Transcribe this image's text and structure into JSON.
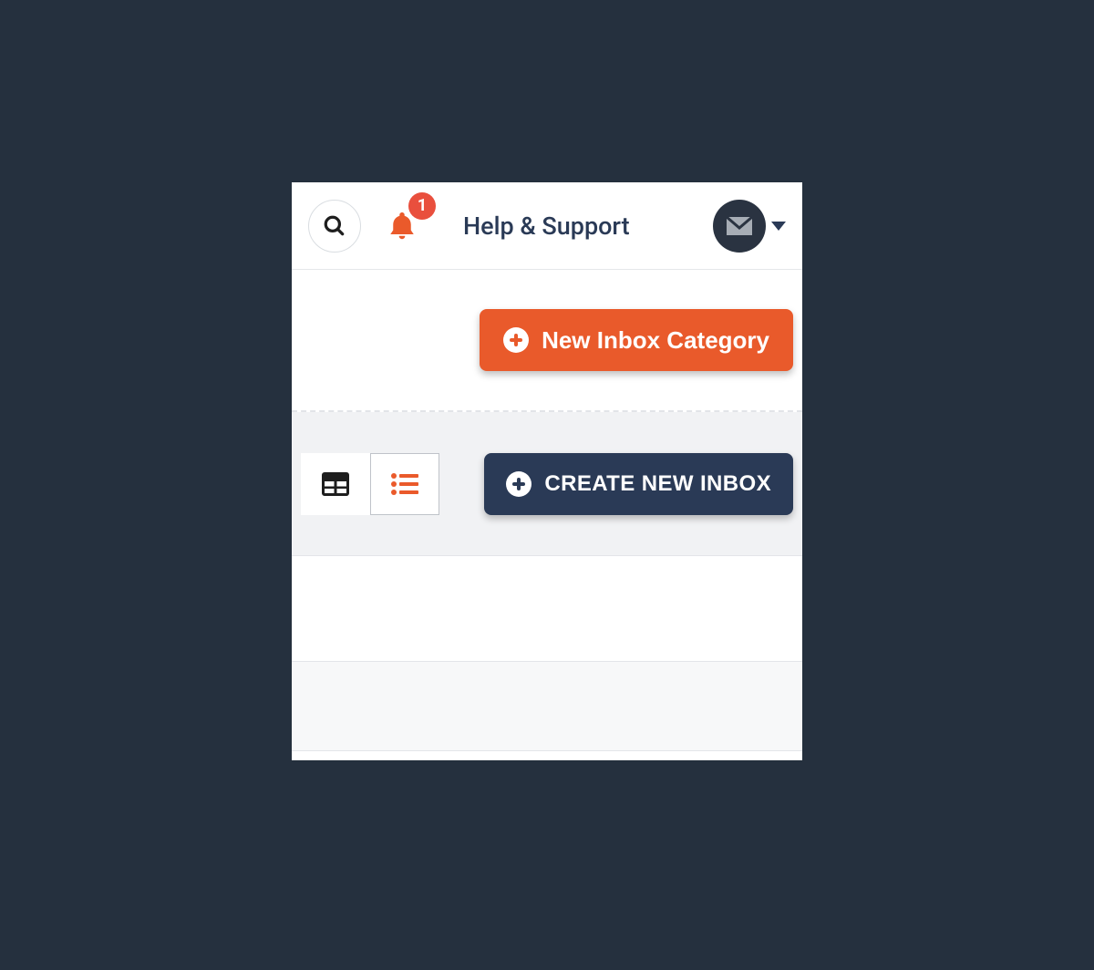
{
  "header": {
    "notification_count": "1",
    "help_label": "Help & Support"
  },
  "actions": {
    "new_category_label": "New Inbox Category",
    "create_inbox_label": "CREATE NEW INBOX"
  },
  "colors": {
    "accent_orange": "#e95a2b",
    "accent_dark": "#2a3a56",
    "badge_red": "#e94f3d"
  }
}
